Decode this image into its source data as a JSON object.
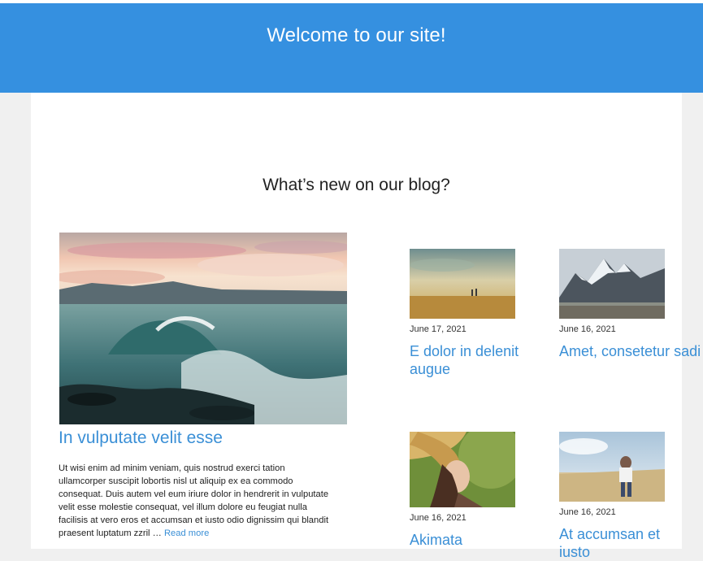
{
  "header": {
    "welcome": "Welcome to our site!"
  },
  "blog": {
    "heading": "What’s new on our blog?",
    "featured": {
      "image": "ocean-waves-sunset-image",
      "title": "In vulputate velit esse",
      "excerpt": "Ut wisi enim ad minim veniam, quis nostrud exerci tation ullamcorper suscipit lobortis nisl ut aliquip ex ea commodo consequat. Duis autem vel eum iriure dolor in hendrerit in vulputate velit esse molestie consequat, vel illum dolore eu feugiat nulla facilisis at vero eros et accumsan et iusto odio dignissim qui blandit praesent luptatum zzril …",
      "read_more": "Read more"
    },
    "posts": [
      {
        "image": "desert-walkers-image",
        "date": "June 17, 2021",
        "title": "E dolor in delenit augue"
      },
      {
        "image": "snowy-mountains-image",
        "date": "June 16, 2021",
        "title": "Amet, consetetur sadi"
      },
      {
        "image": "woman-straw-hat-image",
        "date": "June 16, 2021",
        "title": "Akimata"
      },
      {
        "image": "couple-in-field-image",
        "date": "June 16, 2021",
        "title": "At accumsan et iusto"
      }
    ]
  },
  "colors": {
    "banner": "#3590e0",
    "link": "#3a8fd6",
    "page_bg": "#f0f0f0"
  }
}
